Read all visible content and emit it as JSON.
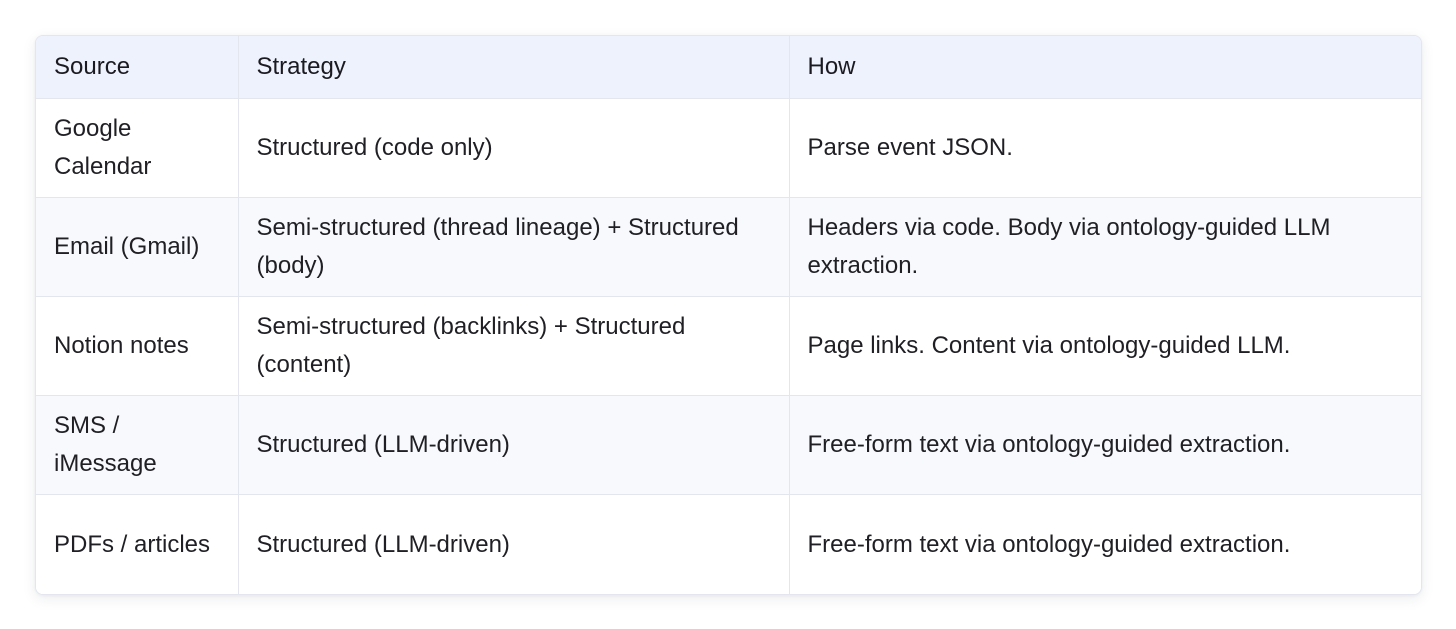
{
  "table": {
    "headers": [
      "Source",
      "Strategy",
      "How"
    ],
    "rows": [
      {
        "source": "Google Calendar",
        "strategy": "Structured (code only)",
        "how": "Parse event JSON."
      },
      {
        "source": "Email (Gmail)",
        "strategy": "Semi-structured (thread lineage) + Structured (body)",
        "how": "Headers via code. Body via ontology-guided LLM extraction."
      },
      {
        "source": "Notion notes",
        "strategy": "Semi-structured (backlinks) + Structured (content)",
        "how": "Page links. Content via ontology-guided LLM."
      },
      {
        "source": "SMS / iMessage",
        "strategy": "Structured (LLM-driven)",
        "how": "Free-form text via ontology-guided extraction."
      },
      {
        "source": "PDFs / articles",
        "strategy": "Structured (LLM-driven)",
        "how": "Free-form text via ontology-guided extraction."
      }
    ]
  }
}
